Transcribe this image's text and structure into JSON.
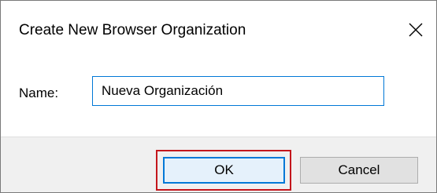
{
  "dialog": {
    "title": "Create New Browser Organization",
    "close_icon": "close-icon"
  },
  "form": {
    "name_label": "Name:",
    "name_value": "Nueva Organización"
  },
  "buttons": {
    "ok_label": "OK",
    "cancel_label": "Cancel"
  },
  "colors": {
    "focus_border": "#0078d7",
    "highlight_annotation": "#c4161c"
  }
}
